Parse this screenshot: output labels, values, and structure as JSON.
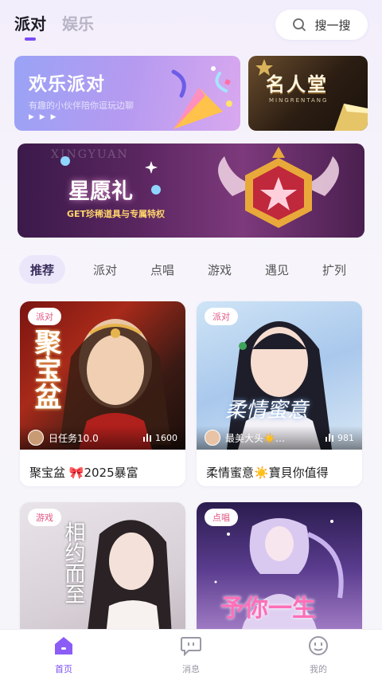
{
  "header": {
    "tabs": [
      {
        "label": "派对",
        "active": true
      },
      {
        "label": "娱乐",
        "active": false
      }
    ],
    "search_label": "搜一搜",
    "search_icon": "search-icon"
  },
  "banners": {
    "party": {
      "title": "欢乐派对",
      "subtitle": "有趣的小伙伴陪你逗玩边聊",
      "arrows": "▶ ▶ ▶"
    },
    "hall": {
      "title": "名人堂",
      "subtitle": "MINGRENTANG"
    },
    "wish": {
      "watermark": "XINGYUAN",
      "title": "星愿礼",
      "subtitle": "GET珍稀道具与专属特权"
    }
  },
  "categories": [
    "推荐",
    "派对",
    "点唱",
    "游戏",
    "遇见",
    "扩列"
  ],
  "rooms": [
    {
      "tag": "派对",
      "owner": "日任务10.0",
      "hot": "1600",
      "name": "聚宝盆 🎀2025暴富",
      "overlay": "聚宝盆"
    },
    {
      "tag": "派对",
      "owner": "最美大头☀️…",
      "hot": "981",
      "name": "柔情蜜意☀️寶貝你值得",
      "overlay": "柔情蜜意"
    },
    {
      "tag": "游戏",
      "owner": "",
      "hot": "",
      "name": "",
      "overlay": "相约而至"
    },
    {
      "tag": "点唱",
      "owner": "",
      "hot": "",
      "name": "",
      "overlay": "予你一生"
    }
  ],
  "bottom_nav": [
    {
      "label": "首页",
      "icon": "home-icon",
      "active": true
    },
    {
      "label": "消息",
      "icon": "message-icon",
      "active": false
    },
    {
      "label": "我的",
      "icon": "profile-icon",
      "active": false
    }
  ],
  "colors": {
    "accent": "#7b4cf6",
    "tag_text": "#e0567f"
  }
}
